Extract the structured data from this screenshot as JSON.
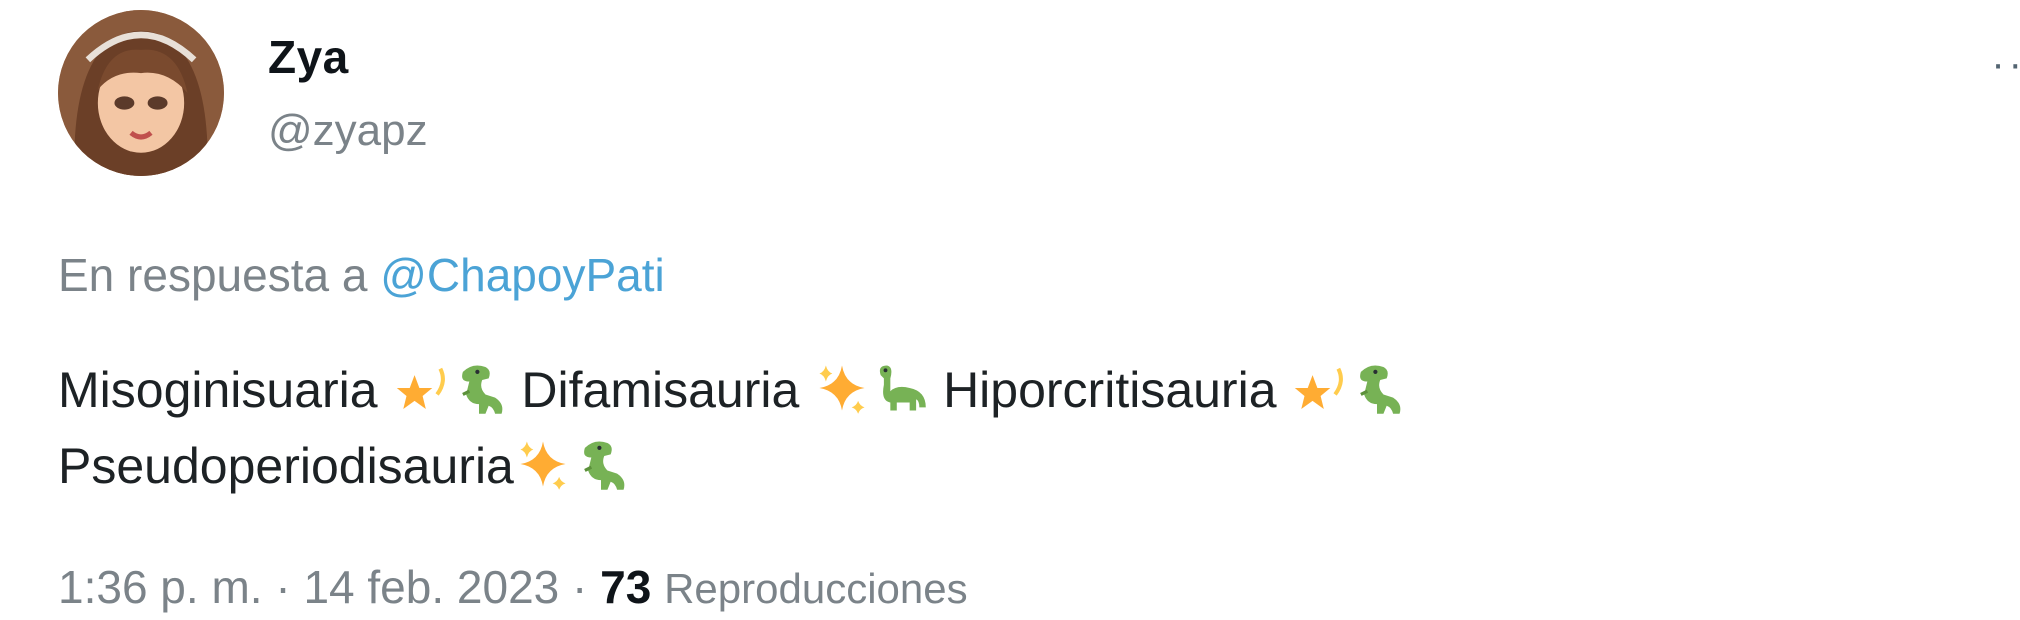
{
  "user": {
    "display_name": "Zya",
    "handle": "@zyapz"
  },
  "more_menu": {
    "icon": "more-horizontal-icon",
    "glyph": "··"
  },
  "reply": {
    "prefix": "En respuesta a",
    "mention": "@ChapoyPati"
  },
  "tweet": {
    "words": [
      "Misoginisuaria",
      "Difamisauria",
      "Hiporcritisauria",
      "Pseudoperiodisauria"
    ],
    "emojis": [
      "dizzy-star-icon",
      "t-rex-icon",
      "sparkles-icon",
      "sauropod-icon",
      "dizzy-star-icon",
      "t-rex-icon",
      "sparkles-icon",
      "t-rex-icon"
    ]
  },
  "meta": {
    "time": "1:36 p. m.",
    "separator": "·",
    "date": "14 feb. 2023",
    "views_count": "73",
    "views_label": "Reproducciones"
  },
  "colors": {
    "text": "#0f1419",
    "secondary": "#7b8389",
    "link": "#4ba3d6",
    "dino_green": "#77b255",
    "star_gold": "#ffac33"
  }
}
